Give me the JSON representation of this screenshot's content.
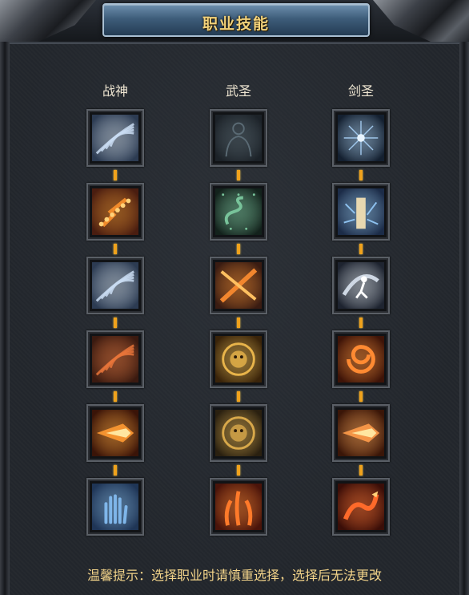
{
  "window": {
    "title": "职业技能"
  },
  "columns": [
    {
      "name": "战神",
      "skills": [
        {
          "icon": "blue-claw-slash-icon",
          "bg": "#2c3b52",
          "accent": "#c9dcf2"
        },
        {
          "icon": "fire-sparks-icon",
          "bg": "#4a1d10",
          "accent": "#f08a2a"
        },
        {
          "icon": "blue-claw-slash-icon",
          "bg": "#2c3b52",
          "accent": "#c9dcf2"
        },
        {
          "icon": "fire-claw-strike-icon",
          "bg": "#3a1a10",
          "accent": "#e8743a"
        },
        {
          "icon": "flame-dash-icon",
          "bg": "#3a1408",
          "accent": "#ff9a32"
        },
        {
          "icon": "blue-palm-icon",
          "bg": "#1f3556",
          "accent": "#7fb6ea"
        }
      ]
    },
    {
      "name": "武圣",
      "skills": [
        {
          "icon": "silhouette-figure-icon",
          "bg": "#1c2228",
          "accent": "#5a6a74"
        },
        {
          "icon": "green-serpent-icon",
          "bg": "#13221c",
          "accent": "#78c39a"
        },
        {
          "icon": "fire-cross-slash-icon",
          "bg": "#3a1c12",
          "accent": "#f2862e"
        },
        {
          "icon": "golden-lion-emblem-icon",
          "bg": "#3a240a",
          "accent": "#e8b44a"
        },
        {
          "icon": "roaring-lion-head-icon",
          "bg": "#2a2010",
          "accent": "#d8a84a"
        },
        {
          "icon": "fire-pillars-icon",
          "bg": "#4a140a",
          "accent": "#ff7a2a"
        }
      ]
    },
    {
      "name": "剑圣",
      "skills": [
        {
          "icon": "ice-star-burst-icon",
          "bg": "#142030",
          "accent": "#9fc6ea"
        },
        {
          "icon": "lightning-tower-icon",
          "bg": "#1c2c48",
          "accent": "#8ec2f0"
        },
        {
          "icon": "wind-runner-icon",
          "bg": "#1e2430",
          "accent": "#cfd8e4"
        },
        {
          "icon": "fire-swirl-icon",
          "bg": "#3e1408",
          "accent": "#ff8a32"
        },
        {
          "icon": "fire-arrow-burst-icon",
          "bg": "#3a1608",
          "accent": "#ff9c4a"
        },
        {
          "icon": "fire-dragon-icon",
          "bg": "#3a0e08",
          "accent": "#ff6a2a"
        }
      ]
    }
  ],
  "tip": "温馨提示：选择职业时请慎重选择，选择后无法更改"
}
